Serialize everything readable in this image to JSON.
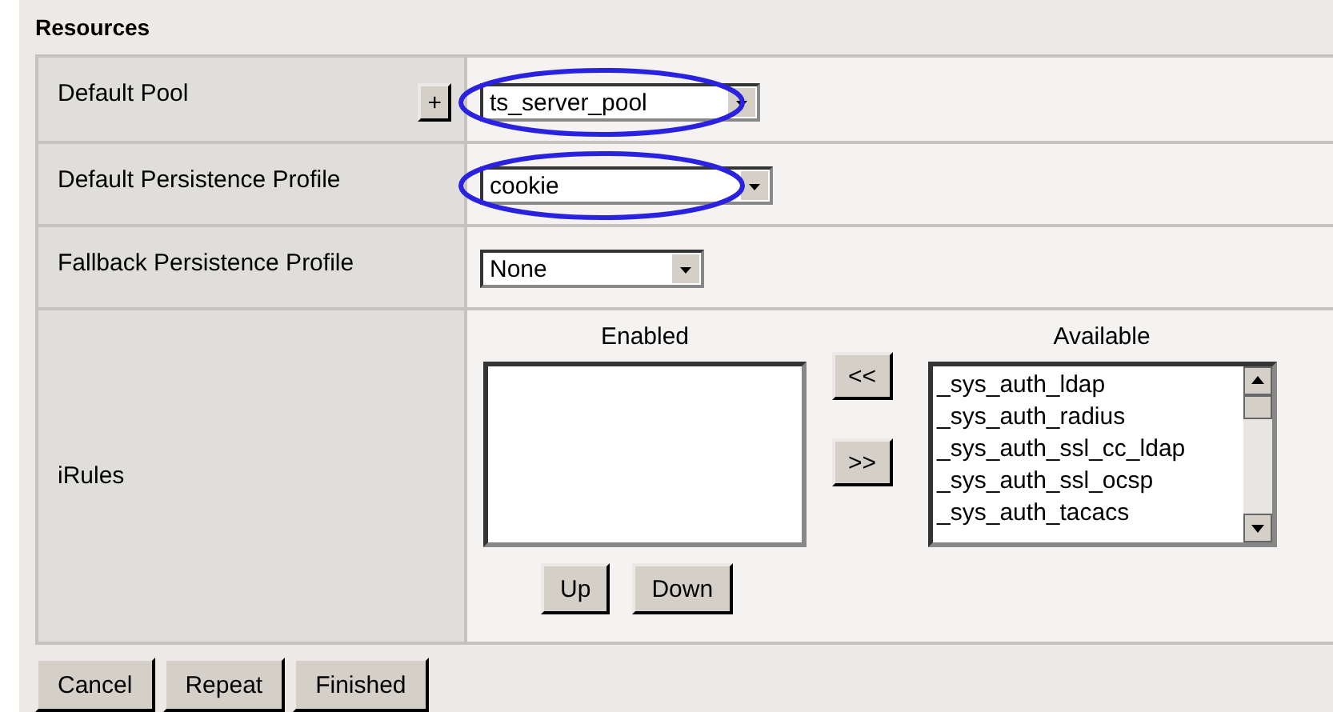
{
  "section_title": "Resources",
  "rows": [
    {
      "kind": "select",
      "label": "Default Pool",
      "add_button": "+",
      "value": "ts_server_pool",
      "highlighted": true
    },
    {
      "kind": "select",
      "label": "Default Persistence Profile",
      "value": "cookie",
      "highlighted": true
    },
    {
      "kind": "select",
      "label": "Fallback Persistence Profile",
      "value": "None",
      "highlighted": false
    },
    {
      "kind": "irules",
      "label": "iRules",
      "enabled_title": "Enabled",
      "available_title": "Available",
      "enabled_items": [],
      "available_items": [
        "_sys_auth_ldap",
        "_sys_auth_radius",
        "_sys_auth_ssl_cc_ldap",
        "_sys_auth_ssl_ocsp",
        "_sys_auth_tacacs"
      ],
      "move_left": "<<",
      "move_right": ">>",
      "up": "Up",
      "down": "Down"
    }
  ],
  "buttons": [
    "Cancel",
    "Repeat",
    "Finished"
  ]
}
